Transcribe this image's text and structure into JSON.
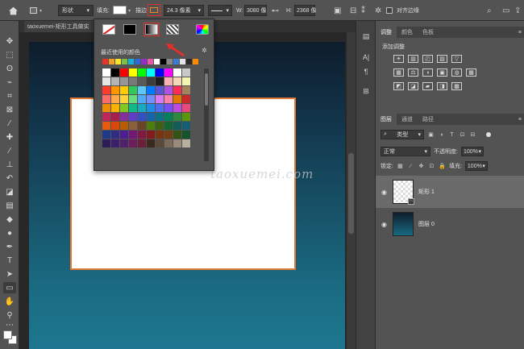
{
  "options_bar": {
    "mode": "形状",
    "fill_label": "填充:",
    "stroke_label": "描边",
    "stroke_width": "24.3 像素",
    "w_label": "W:",
    "w_value": "3080 像",
    "h_label": "H:",
    "h_value": "2368 像",
    "align_edges_label": "对齐边缘",
    "fill_color": "#ffffff",
    "stroke_color": "#ef8a2b"
  },
  "document": {
    "tab_title": "taoxuemei-矩形工具做实",
    "watermark": "taoxuemei.com"
  },
  "stroke_popup": {
    "recent_label": "最近使用的颜色",
    "recent_colors": [
      "#e8332a",
      "#f19e2a",
      "#f3e52a",
      "#7bc043",
      "#19b1d6",
      "#2c6ad1",
      "#8f2fc7",
      "#eb57a8",
      "#ffffff",
      "#000000",
      "#888888",
      "#3b7bd4",
      "#e4e4e4",
      "#2a2a2a",
      "#ff8a00"
    ],
    "swatches": [
      "#ffffff",
      "#000000",
      "#ff0000",
      "#ffff00",
      "#00ff00",
      "#00ffff",
      "#0000ff",
      "#ff00ff",
      "#ffffff",
      "#c8c8c8",
      "#e6e6e6",
      "#b4b4b4",
      "#969696",
      "#787878",
      "#5a5a5a",
      "#3c3c3c",
      "#1e1e1e",
      "#f5b3b3",
      "#f5d8b3",
      "#f5f5b3",
      "#ff3b30",
      "#ff9500",
      "#ffcc00",
      "#34c759",
      "#5ac8fa",
      "#007aff",
      "#5856d6",
      "#af52de",
      "#ff2d55",
      "#a2845e",
      "#ff6b6b",
      "#ffa94d",
      "#ffd43b",
      "#69db7c",
      "#4dabf7",
      "#748ffc",
      "#da77f2",
      "#f783ac",
      "#e67700",
      "#c92a2a",
      "#f08c00",
      "#fab005",
      "#82c91e",
      "#12b886",
      "#15aabf",
      "#228be6",
      "#4c6ef5",
      "#7950f2",
      "#be4bdb",
      "#e64980",
      "#c2255c",
      "#a61e4d",
      "#862e9c",
      "#5f3dc4",
      "#364fc7",
      "#1864ab",
      "#0b7285",
      "#087f5b",
      "#2b8a3e",
      "#5c940d",
      "#e8590c",
      "#d9480f",
      "#b85c00",
      "#8b5e3c",
      "#6b4423",
      "#4d7c0f",
      "#3f6212",
      "#166534",
      "#115e59",
      "#155e75",
      "#1e3a8a",
      "#312e81",
      "#4c1d95",
      "#701a75",
      "#831843",
      "#7f1d1d",
      "#78350f",
      "#713f12",
      "#365314",
      "#14532d",
      "#2d1b5a",
      "#3b1f6b",
      "#511f6b",
      "#6b1f5a",
      "#6b1f3b",
      "#3b2a1f",
      "#5a4a3a",
      "#7a6a5a",
      "#9a8a7a",
      "#bab0a0"
    ]
  },
  "panels": {
    "top_tabs": [
      "调整",
      "颜色",
      "色板"
    ],
    "adj_title": "添加调整",
    "adj_row1": [
      "☀",
      "▥",
      "◰",
      "▨",
      "▽"
    ],
    "adj_row2": [
      "▦",
      "⚖",
      "◑",
      "▣",
      "◍",
      "▦"
    ],
    "adj_row3": [
      "◩",
      "◪",
      "▰",
      "◨",
      "▩"
    ],
    "layer_tabs": [
      "图层",
      "通道",
      "路径"
    ],
    "filter_kind": "类型",
    "blend_mode": "正常",
    "opacity_label": "不透明度:",
    "opacity_value": "100%",
    "lock_label": "锁定:",
    "fill_label": "填充:",
    "fill_value": "100%",
    "layers": [
      {
        "name": "矩形 1"
      },
      {
        "name": "图层 0"
      }
    ]
  }
}
